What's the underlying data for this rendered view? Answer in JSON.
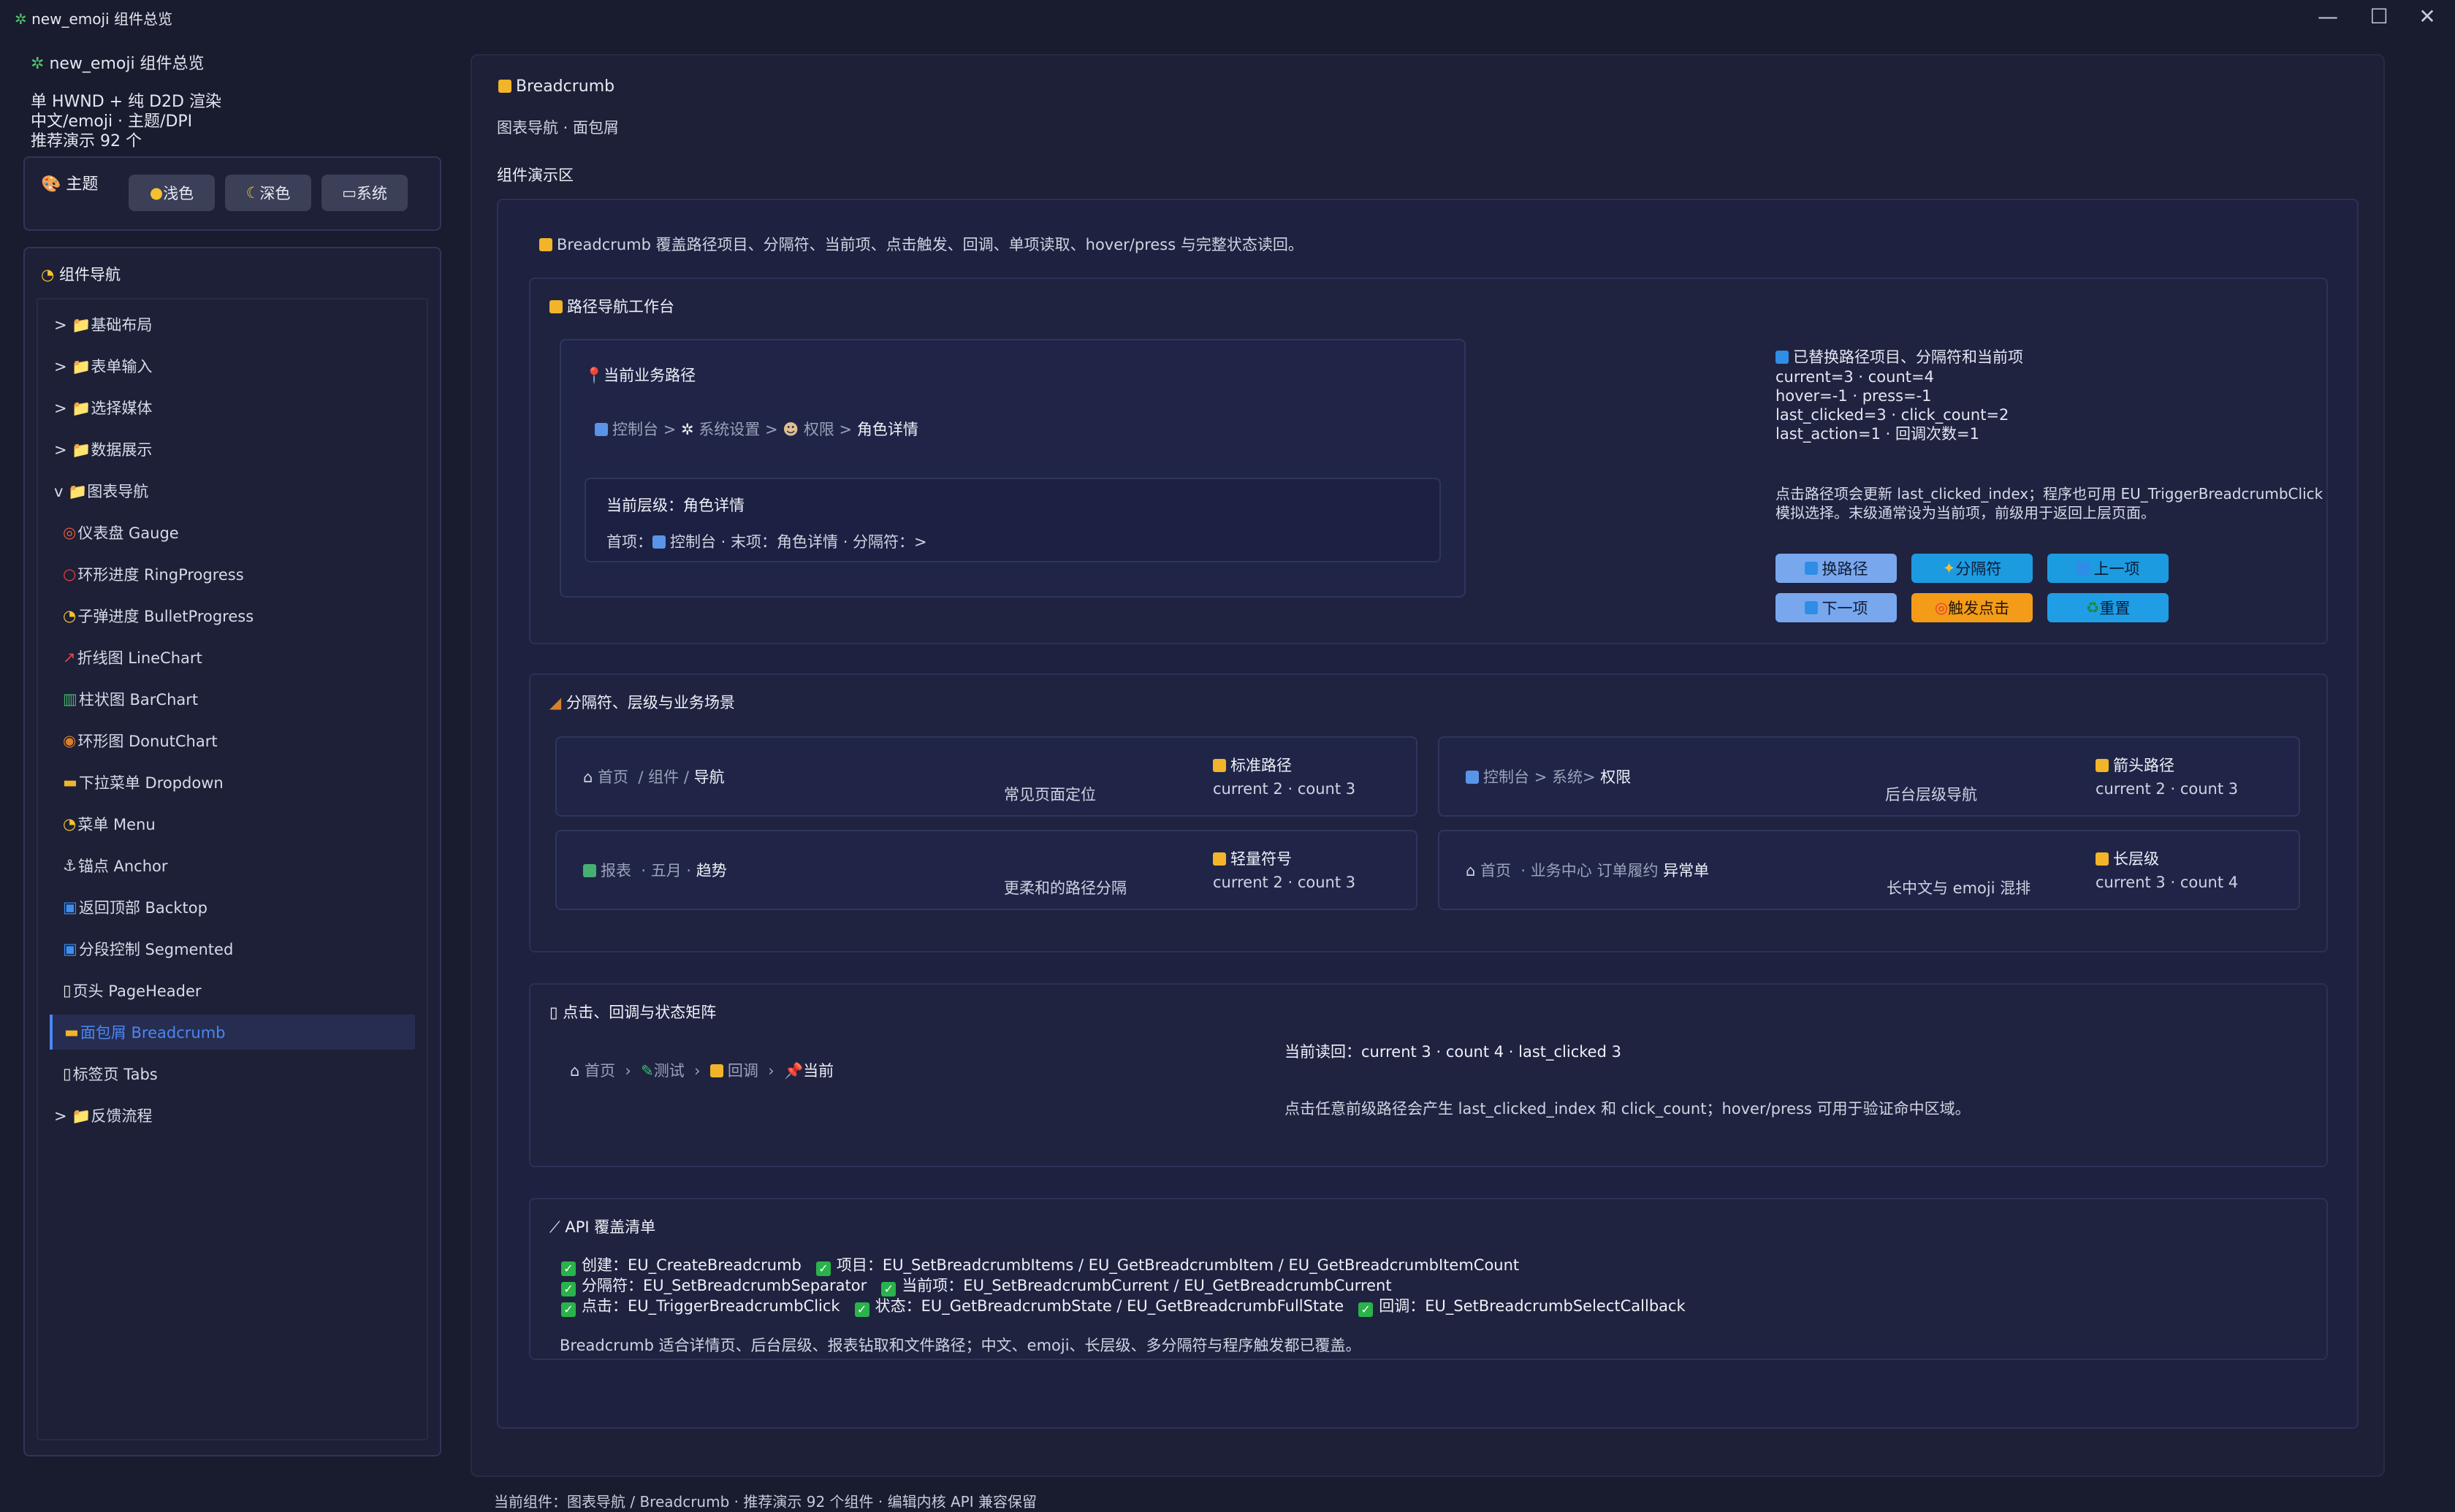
{
  "window": {
    "title": "new_emoji 组件总览",
    "minimize": "—",
    "maximize": "☐",
    "close": "✕"
  },
  "sidebar": {
    "app_title": "new_emoji 组件总览",
    "info_lines": [
      "单 HWND + 纯 D2D 渲染",
      "中文/emoji · 主题/DPI",
      "推荐演示 92 个"
    ],
    "theme": {
      "label": "主题",
      "buttons": [
        "浅色",
        "深色",
        "系统"
      ]
    },
    "nav": {
      "label": "组件导航",
      "items": [
        {
          "label": "> 📁基础布局"
        },
        {
          "label": "> 📁表单输入"
        },
        {
          "label": "> 📁选择媒体"
        },
        {
          "label": "> 📁数据展示"
        },
        {
          "label": "v 📁图表导航"
        },
        {
          "label": "仪表盘 Gauge"
        },
        {
          "label": "环形进度 RingProgress"
        },
        {
          "label": "子弹进度 BulletProgress"
        },
        {
          "label": "折线图 LineChart"
        },
        {
          "label": "柱状图 BarChart"
        },
        {
          "label": "环形图 DonutChart"
        },
        {
          "label": "下拉菜单 Dropdown"
        },
        {
          "label": "菜单 Menu"
        },
        {
          "label": "锚点 Anchor"
        },
        {
          "label": "返回顶部 Backtop"
        },
        {
          "label": "分段控制 Segmented"
        },
        {
          "label": "页头 PageHeader"
        },
        {
          "label": "面包屑 Breadcrumb"
        },
        {
          "label": "标签页 Tabs"
        },
        {
          "label": "> 📁反馈流程"
        }
      ]
    }
  },
  "main": {
    "title": "Breadcrumb",
    "subtitle": "图表导航 · 面包屑",
    "demo_label": "组件演示区",
    "intro": "Breadcrumb 覆盖路径项目、分隔符、当前项、点击触发、回调、单项读取、hover/press 与完整状态读回。",
    "workbench": {
      "title": "路径导航工作台",
      "path_title": "当前业务路径",
      "path": {
        "p1": "控制台",
        "sep1": ">",
        "p2": "系统设置",
        "sep2": ">",
        "p3": "权限",
        "sep3": ">",
        "p4": "角色详情"
      },
      "level_label": "当前层级：角色详情",
      "level_detail": "首项：",
      "level_detail_2": "控制台 · 末项：角色详情 · 分隔符：>",
      "status_title": "已替换路径项目、分隔符和当前项",
      "status_lines": [
        "current=3 · count=4",
        "hover=-1 · press=-1",
        "last_clicked=3 · click_count=2",
        "last_action=1 · 回调次数=1"
      ],
      "note": "点击路径项会更新 last_clicked_index；程序也可用 EU_TriggerBreadcrumbClick 模拟选择。末级通常设为当前项，前级用于返回上层页面。",
      "buttons": [
        "换路径",
        "分隔符",
        "上一项",
        "下一项",
        "触发点击",
        "重置"
      ]
    },
    "separators": {
      "title": "分隔符、层级与业务场景",
      "cards": [
        {
          "crumbs": [
            "首页",
            "/",
            "组件",
            "/",
            "导航"
          ],
          "caption": "常见页面定位",
          "tag": "标准路径",
          "stat": "current 2 · count 3"
        },
        {
          "crumbs": [
            "控制台",
            ">",
            "系统",
            ">",
            "权限"
          ],
          "caption": "后台层级导航",
          "tag": "箭头路径",
          "stat": "current 2 · count 3"
        },
        {
          "crumbs": [
            "报表",
            "·",
            "五月",
            "·",
            "趋势"
          ],
          "caption": "更柔和的路径分隔",
          "tag": "轻量符号",
          "stat": "current 2 · count 3"
        },
        {
          "crumbs": [
            "首页",
            "·",
            "业务中心",
            "订单履约",
            "异常单"
          ],
          "caption": "长中文与 emoji 混排",
          "tag": "长层级",
          "stat": "current 3 · count 4"
        }
      ]
    },
    "click": {
      "title": "点击、回调与状态矩阵",
      "crumbs": [
        "首页",
        "›",
        "测试",
        "›",
        "回调",
        "›",
        "当前"
      ],
      "readback": "当前读回：current 3 · count 4 · last_clicked 3",
      "note": "点击任意前级路径会产生 last_clicked_index 和 click_count；hover/press 可用于验证命中区域。"
    },
    "api": {
      "title": "API 覆盖清单",
      "row1": [
        "创建：EU_CreateBreadcrumb",
        "项目：EU_SetBreadcrumbItems / EU_GetBreadcrumbItem / EU_GetBreadcrumbItemCount"
      ],
      "row2": [
        "分隔符：EU_SetBreadcrumbSeparator",
        "当前项：EU_SetBreadcrumbCurrent / EU_GetBreadcrumbCurrent"
      ],
      "row3": [
        "点击：EU_TriggerBreadcrumbClick",
        "状态：EU_GetBreadcrumbState / EU_GetBreadcrumbFullState",
        "回调：EU_SetBreadcrumbSelectCallback"
      ],
      "summary": "Breadcrumb 适合详情页、后台层级、报表钻取和文件路径；中文、emoji、长层级、多分隔符与程序触发都已覆盖。"
    }
  },
  "status_bar": "当前组件：图表导航 / Breadcrumb · 推荐演示 92 个组件 · 编辑内核 API 兼容保留",
  "colors": {
    "accent": "#4c86f2",
    "bg": "#191b2e",
    "panel": "#1d2037",
    "orange": "#f49c17"
  }
}
